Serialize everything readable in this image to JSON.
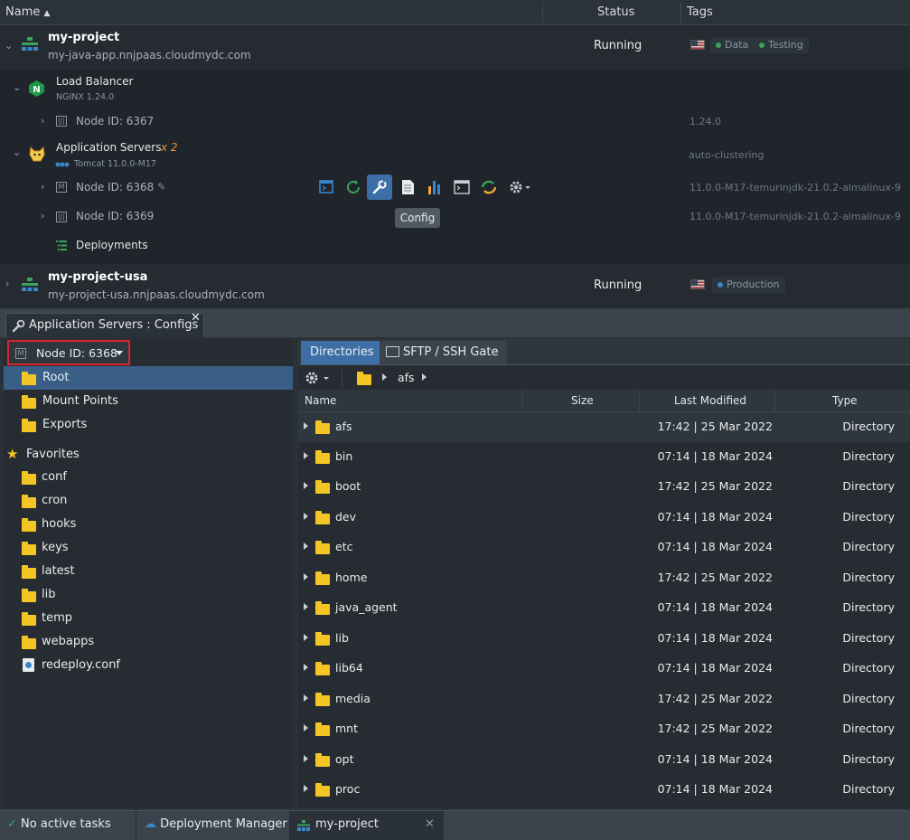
{
  "header": {
    "name": "Name",
    "status": "Status",
    "tags": "Tags"
  },
  "envs": [
    {
      "name": "my-project",
      "url": "my-java-app.nnjpaas.cloudmydc.com",
      "status": "Running",
      "tags": [
        "Data",
        "Testing"
      ],
      "groups": [
        {
          "name": "Load Balancer",
          "version": "NGINX 1.24.0",
          "tag": "",
          "nodes": [
            {
              "label": "Node ID: 6367",
              "tag": "1.24.0"
            }
          ]
        },
        {
          "name": "Application Servers",
          "count": "x 2",
          "version": "Tomcat 11.0.0-M17",
          "tag": "auto-clustering",
          "nodes": [
            {
              "label": "Node ID: 6368",
              "tag": "11.0.0-M17-temurinjdk-21.0.2-almalinux-9"
            },
            {
              "label": "Node ID: 6369",
              "tag": "11.0.0-M17-temurinjdk-21.0.2-almalinux-9"
            }
          ]
        }
      ],
      "deployments": "Deployments"
    },
    {
      "name": "my-project-usa",
      "url": "my-project-usa.nnjpaas.cloudmydc.com",
      "status": "Running",
      "tags": [
        "Production"
      ]
    }
  ],
  "tooltip": "Config",
  "toolbar_icons": [
    "web-ssh-icon",
    "restart-icon",
    "config-icon",
    "logs-icon",
    "statistics-icon",
    "terminal-icon",
    "redeploy-icon",
    "settings-icon"
  ],
  "config_panel": {
    "tab_title": "Application Servers : Configs",
    "node_select": "Node ID: 6368",
    "tree": [
      {
        "label": "Root",
        "selected": true
      },
      {
        "label": "Mount Points"
      },
      {
        "label": "Exports"
      }
    ],
    "favorites_label": "Favorites",
    "favorites": [
      "conf",
      "cron",
      "hooks",
      "keys",
      "latest",
      "lib",
      "temp",
      "webapps",
      "redeploy.conf"
    ],
    "right_tabs": [
      "Directories",
      "SFTP / SSH Gate"
    ],
    "breadcrumb": "afs",
    "columns": {
      "name": "Name",
      "size": "Size",
      "modified": "Last Modified",
      "type": "Type"
    },
    "files": [
      {
        "name": "afs",
        "modified": "17:42 | 25 Mar 2022",
        "type": "Directory"
      },
      {
        "name": "bin",
        "modified": "07:14 | 18 Mar 2024",
        "type": "Directory"
      },
      {
        "name": "boot",
        "modified": "17:42 | 25 Mar 2022",
        "type": "Directory"
      },
      {
        "name": "dev",
        "modified": "07:14 | 18 Mar 2024",
        "type": "Directory"
      },
      {
        "name": "etc",
        "modified": "07:14 | 18 Mar 2024",
        "type": "Directory"
      },
      {
        "name": "home",
        "modified": "17:42 | 25 Mar 2022",
        "type": "Directory"
      },
      {
        "name": "java_agent",
        "modified": "07:14 | 18 Mar 2024",
        "type": "Directory"
      },
      {
        "name": "lib",
        "modified": "07:14 | 18 Mar 2024",
        "type": "Directory"
      },
      {
        "name": "lib64",
        "modified": "07:14 | 18 Mar 2024",
        "type": "Directory"
      },
      {
        "name": "media",
        "modified": "17:42 | 25 Mar 2022",
        "type": "Directory"
      },
      {
        "name": "mnt",
        "modified": "17:42 | 25 Mar 2022",
        "type": "Directory"
      },
      {
        "name": "opt",
        "modified": "07:14 | 18 Mar 2024",
        "type": "Directory"
      },
      {
        "name": "proc",
        "modified": "07:14 | 18 Mar 2024",
        "type": "Directory"
      }
    ]
  },
  "statusbar": {
    "tasks": "No active tasks",
    "deployment_manager": "Deployment Manager",
    "project": "my-project"
  },
  "colors": {
    "accent": "#3d6fa6",
    "folder": "#f3c623",
    "highlight": "#d9232e",
    "tag_green": "#3aa35a",
    "tag_blue": "#3a86c8"
  }
}
